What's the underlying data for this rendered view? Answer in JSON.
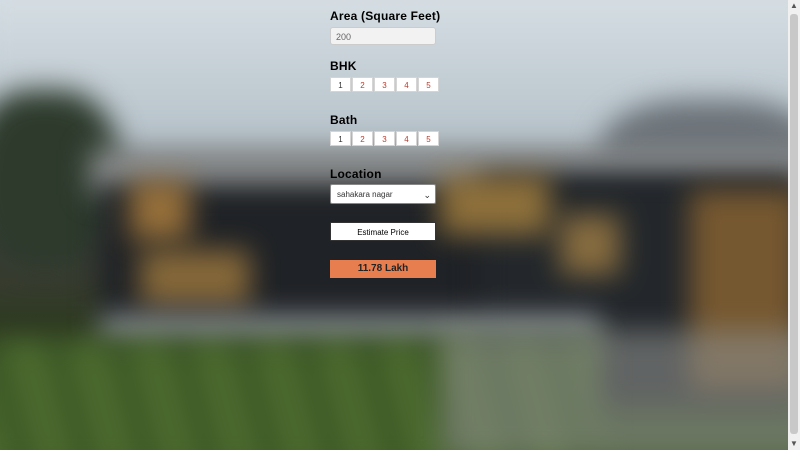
{
  "form": {
    "area_label": "Area (Square Feet)",
    "area_value": "200",
    "bhk_label": "BHK",
    "bhk_options": [
      "1",
      "2",
      "3",
      "4",
      "5"
    ],
    "bath_label": "Bath",
    "bath_options": [
      "1",
      "2",
      "3",
      "4",
      "5"
    ],
    "location_label": "Location",
    "location_selected": "sahakara nagar",
    "estimate_button": "Estimate Price",
    "result": "11.78 Lakh"
  },
  "colors": {
    "result_bg": "#e67e50",
    "option_text": "#c0392b"
  }
}
